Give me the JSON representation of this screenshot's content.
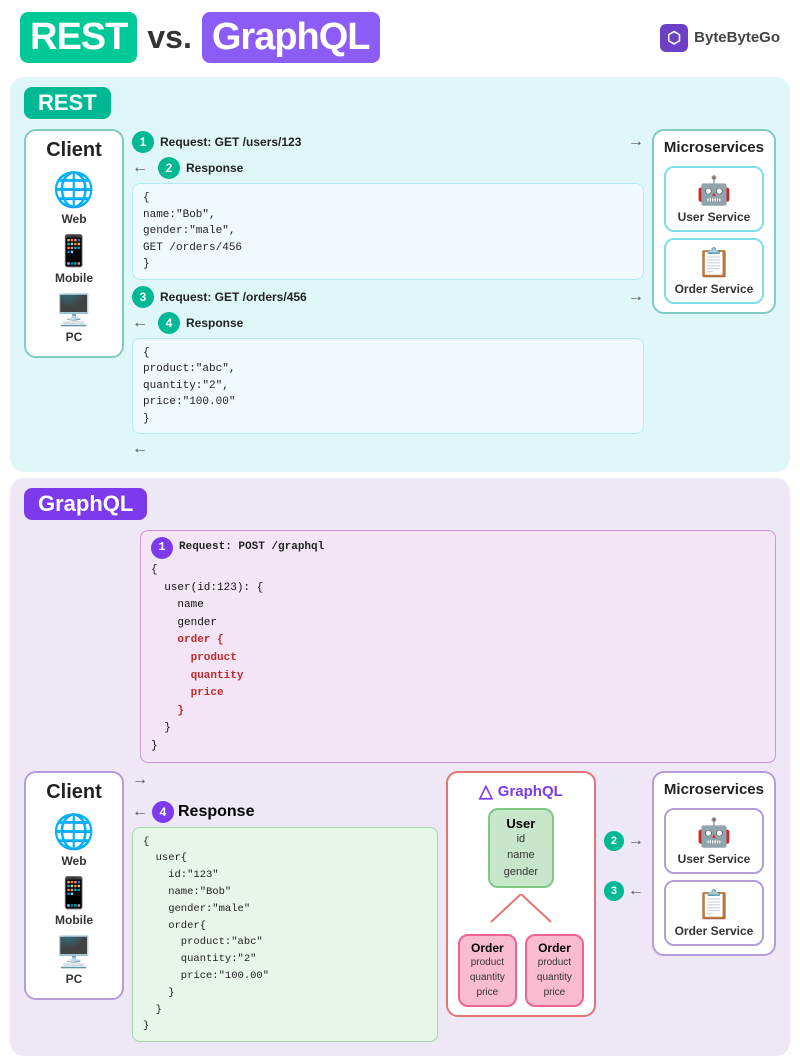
{
  "header": {
    "title_rest": "REST",
    "title_vs": "vs.",
    "title_graphql": "GraphQL",
    "brand": "ByteByteGo"
  },
  "rest_section": {
    "label": "REST",
    "client": {
      "title": "Client",
      "items": [
        {
          "label": "Web",
          "icon": "🌐"
        },
        {
          "label": "Mobile",
          "icon": "📱"
        },
        {
          "label": "PC",
          "icon": "🖥️"
        }
      ]
    },
    "microservices": {
      "title": "Microservices",
      "services": [
        {
          "label": "User Service",
          "icon": "🤖"
        },
        {
          "label": "Order Service",
          "icon": "📋"
        }
      ]
    },
    "steps": [
      {
        "num": "1",
        "text": "Request: GET /users/123"
      },
      {
        "num": "2",
        "text": "Response"
      },
      {
        "num": "3",
        "text": "Request: GET /orders/456"
      },
      {
        "num": "4",
        "text": "Response"
      }
    ],
    "response1": {
      "lines": [
        "{",
        "  name:\"Bob\",",
        "  gender:\"male\",",
        "  GET /orders/456",
        "}"
      ]
    },
    "response2": {
      "lines": [
        "{",
        "  product:\"abc\",",
        "  quantity:\"2\",",
        "  price:\"100.00\"",
        "}"
      ]
    }
  },
  "graphql_section": {
    "label": "GraphQL",
    "client": {
      "title": "Client",
      "items": [
        {
          "label": "Web",
          "icon": "🌐"
        },
        {
          "label": "Mobile",
          "icon": "📱"
        },
        {
          "label": "PC",
          "icon": "🖥️"
        }
      ]
    },
    "request": {
      "step": "1",
      "title": "Request: POST /graphql",
      "lines_black": [
        "{",
        "  user(id:123): {",
        "    name",
        "    gender"
      ],
      "lines_red": [
        "    order {",
        "      product",
        "      quantity",
        "      price",
        "    }"
      ],
      "lines_close": [
        "  }",
        "}"
      ]
    },
    "server": {
      "title": "GraphQL",
      "user_node": {
        "label": "User",
        "fields": [
          "id",
          "name",
          "gender"
        ]
      },
      "order_nodes": [
        {
          "label": "Order",
          "fields": [
            "product",
            "quantity",
            "price"
          ]
        },
        {
          "label": "Order",
          "fields": [
            "product",
            "quantity",
            "price"
          ]
        }
      ]
    },
    "microservices": {
      "title": "Microservices",
      "services": [
        {
          "label": "User Service",
          "icon": "🤖"
        },
        {
          "label": "Order Service",
          "icon": "📋"
        }
      ]
    },
    "arrows": [
      {
        "num": "2",
        "dir": "right"
      },
      {
        "num": "3",
        "dir": "left"
      }
    ],
    "response": {
      "step": "4",
      "title": "Response",
      "lines": [
        "{",
        "  user{",
        "    id:\"123\"",
        "    name:\"Bob\"",
        "    gender:\"male\"",
        "    order{",
        "      product:\"abc\"",
        "      quantity:\"2\"",
        "      price:\"100.00\"",
        "    }",
        "  }",
        "}"
      ]
    }
  }
}
